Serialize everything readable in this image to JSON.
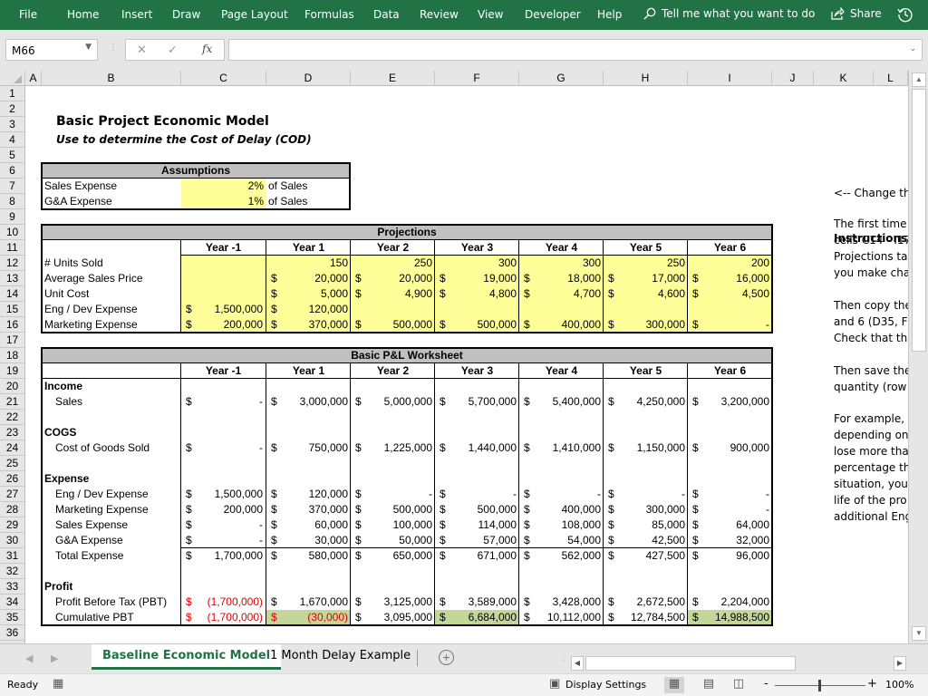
{
  "ribbon": {
    "tabs": [
      "File",
      "Home",
      "Insert",
      "Draw",
      "Page Layout",
      "Formulas",
      "Data",
      "Review",
      "View",
      "Developer",
      "Help"
    ],
    "tell_me": "Tell me what you want to do",
    "share": "Share"
  },
  "formula_bar": {
    "name_box": "M66",
    "fx_label": "fx",
    "formula": ""
  },
  "columns": [
    "A",
    "B",
    "C",
    "D",
    "E",
    "F",
    "G",
    "H",
    "I",
    "J",
    "K",
    "L"
  ],
  "rows": [
    "1",
    "2",
    "3",
    "4",
    "5",
    "6",
    "7",
    "8",
    "9",
    "10",
    "11",
    "12",
    "13",
    "14",
    "15",
    "16",
    "17",
    "18",
    "19",
    "20",
    "21",
    "22",
    "23",
    "24",
    "25",
    "26",
    "27",
    "28",
    "29",
    "30",
    "31",
    "32",
    "33",
    "34",
    "35",
    "36"
  ],
  "header": {
    "title": "Basic Project Economic Model",
    "subtitle": "Use to determine the Cost of Delay (COD)"
  },
  "assumptions": {
    "title": "Assumptions",
    "rows": [
      {
        "label": "Sales Expense",
        "value": "2%",
        "unit": "of Sales"
      },
      {
        "label": "G&A Expense",
        "value": "1%",
        "unit": "of Sales"
      }
    ]
  },
  "years": [
    "Year -1",
    "Year 1",
    "Year 2",
    "Year 3",
    "Year 4",
    "Year 5",
    "Year 6"
  ],
  "projections": {
    "title": "Projections",
    "rows": [
      {
        "label": "# Units Sold",
        "cur": [
          "",
          "",
          "",
          "",
          "",
          "",
          ""
        ],
        "vals": [
          "",
          "150",
          "250",
          "300",
          "300",
          "250",
          "200"
        ]
      },
      {
        "label": "Average Sales Price",
        "cur": [
          "",
          "$",
          "$",
          "$",
          "$",
          "$",
          "$"
        ],
        "vals": [
          "",
          "20,000",
          "20,000",
          "19,000",
          "18,000",
          "17,000",
          "16,000"
        ]
      },
      {
        "label": "Unit Cost",
        "cur": [
          "",
          "$",
          "$",
          "$",
          "$",
          "$",
          "$"
        ],
        "vals": [
          "",
          "5,000",
          "4,900",
          "4,800",
          "4,700",
          "4,600",
          "4,500"
        ]
      },
      {
        "label": "Eng / Dev Expense",
        "cur": [
          "$",
          "$",
          "",
          "",
          "",
          "",
          ""
        ],
        "vals": [
          "1,500,000",
          "120,000",
          "",
          "",
          "",
          "",
          ""
        ]
      },
      {
        "label": "Marketing Expense",
        "cur": [
          "$",
          "$",
          "$",
          "$",
          "$",
          "$",
          "$"
        ],
        "vals": [
          "200,000",
          "370,000",
          "500,000",
          "500,000",
          "400,000",
          "300,000",
          "-"
        ]
      }
    ]
  },
  "pl": {
    "title": "Basic P&L Worksheet",
    "sections": {
      "income": "Income",
      "cogs": "COGS",
      "expense": "Expense",
      "profit": "Profit"
    },
    "sales": {
      "label": "Sales",
      "vals": [
        "-",
        "3,000,000",
        "5,000,000",
        "5,700,000",
        "5,400,000",
        "4,250,000",
        "3,200,000"
      ]
    },
    "cogs_row": {
      "label": "Cost of Goods Sold",
      "vals": [
        "-",
        "750,000",
        "1,225,000",
        "1,440,000",
        "1,410,000",
        "1,150,000",
        "900,000"
      ]
    },
    "expenses": [
      {
        "label": "Eng / Dev Expense",
        "vals": [
          "1,500,000",
          "120,000",
          "-",
          "-",
          "-",
          "-",
          "-"
        ]
      },
      {
        "label": "Marketing Expense",
        "vals": [
          "200,000",
          "370,000",
          "500,000",
          "500,000",
          "400,000",
          "300,000",
          "-"
        ]
      },
      {
        "label": "Sales Expense",
        "vals": [
          "-",
          "60,000",
          "100,000",
          "114,000",
          "108,000",
          "85,000",
          "64,000"
        ]
      },
      {
        "label": "G&A Expense",
        "vals": [
          "-",
          "30,000",
          "50,000",
          "57,000",
          "54,000",
          "42,500",
          "32,000"
        ]
      }
    ],
    "total_expense": {
      "label": "Total Expense",
      "vals": [
        "1,700,000",
        "580,000",
        "650,000",
        "671,000",
        "562,000",
        "427,500",
        "96,000"
      ]
    },
    "pbt": {
      "label": "Profit Before Tax (PBT)",
      "vals": [
        "(1,700,000)",
        "1,670,000",
        "3,125,000",
        "3,589,000",
        "3,428,000",
        "2,672,500",
        "2,204,000"
      ],
      "negative": [
        true,
        false,
        false,
        false,
        false,
        false,
        false
      ]
    },
    "cum_pbt": {
      "label": "Cumulative PBT",
      "vals": [
        "(1,700,000)",
        "(30,000)",
        "3,095,000",
        "6,684,000",
        "10,112,000",
        "12,784,500",
        "14,988,500"
      ],
      "negative": [
        true,
        true,
        false,
        false,
        false,
        false,
        false
      ],
      "highlight": [
        false,
        true,
        false,
        true,
        false,
        false,
        true
      ]
    }
  },
  "currency_symbol": "$",
  "instructions": {
    "heading": "Instructions:",
    "lines": [
      {
        "row": 12,
        "text": "<-- Change th"
      },
      {
        "row": 14,
        "text": "The first time"
      },
      {
        "row": 15,
        "text": "cells C14 - I17"
      },
      {
        "row": 16,
        "text": "Projections ta"
      },
      {
        "row": 17,
        "text": "you make cha"
      },
      {
        "row": 19,
        "text": "Then copy the"
      },
      {
        "row": 20,
        "text": "and 6 (D35, F:"
      },
      {
        "row": 21,
        "text": "Check that th"
      },
      {
        "row": 23,
        "text": "Then save the"
      },
      {
        "row": 24,
        "text": "quantity (row"
      },
      {
        "row": 26,
        "text": "For example,"
      },
      {
        "row": 27,
        "text": "depending on"
      },
      {
        "row": 28,
        "text": "lose more tha"
      },
      {
        "row": 29,
        "text": "percentage th"
      },
      {
        "row": 30,
        "text": "situation, you"
      },
      {
        "row": 31,
        "text": "life of the pro"
      },
      {
        "row": 32,
        "text": "additional Eng"
      }
    ]
  },
  "sheet_tabs": [
    "Baseline Economic Model",
    "1 Month Delay Example"
  ],
  "active_sheet": "Baseline Economic Model",
  "status": {
    "ready": "Ready",
    "display_settings": "Display Settings",
    "zoom": "100%"
  },
  "colors": {
    "ribbon": "#217346",
    "input_yellow": "#ffff99",
    "header_gray": "#c0c0c0",
    "highlight_green": "#c4d79b",
    "negative_red": "#e00000"
  }
}
